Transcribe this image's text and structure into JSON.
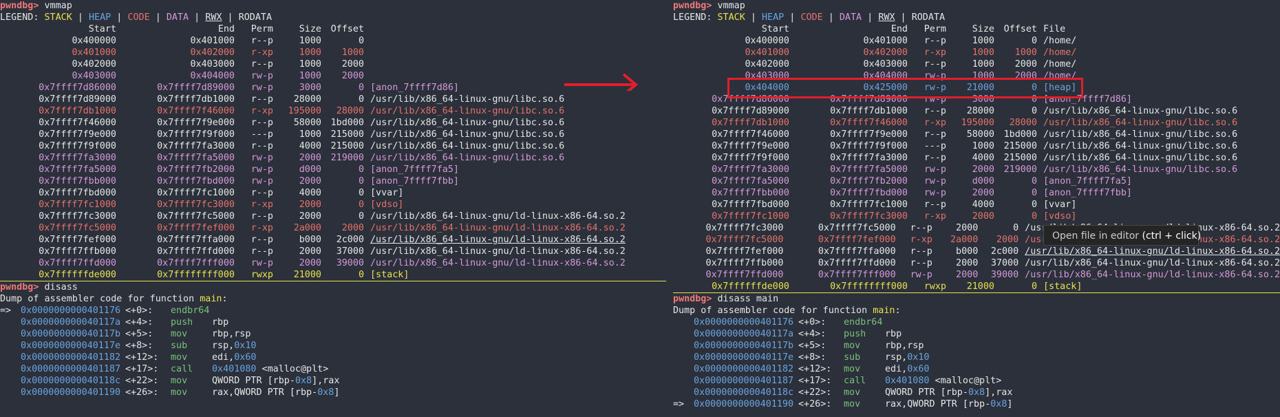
{
  "prompt": "pwndbg>",
  "legend_label": "LEGEND:",
  "legend": [
    "STACK",
    "HEAP",
    "CODE",
    "DATA",
    "RWX",
    "RODATA"
  ],
  "colors": {
    "stack": "#e8e34c",
    "heap": "#6aa4e0",
    "code": "#e5736a",
    "data": "#d59ad8",
    "rodata": "#e6e6e6",
    "annotation_red": "#e41e2a"
  },
  "left": {
    "cmd1": "vmmap",
    "headers": [
      "Start",
      "End",
      "Perm",
      "Size",
      "Offset"
    ],
    "rows": [
      {
        "start": "0x400000",
        "end": "0x401000",
        "perm": "r--p",
        "size": "1000",
        "offset": "0",
        "file": "",
        "type": "rodata"
      },
      {
        "start": "0x401000",
        "end": "0x402000",
        "perm": "r-xp",
        "size": "1000",
        "offset": "1000",
        "file": "",
        "type": "code"
      },
      {
        "start": "0x402000",
        "end": "0x403000",
        "perm": "r--p",
        "size": "1000",
        "offset": "2000",
        "file": "",
        "type": "rodata"
      },
      {
        "start": "0x403000",
        "end": "0x404000",
        "perm": "rw-p",
        "size": "1000",
        "offset": "2000",
        "file": "",
        "type": "data"
      },
      {
        "start": "0x7ffff7d86000",
        "end": "0x7ffff7d89000",
        "perm": "rw-p",
        "size": "3000",
        "offset": "0",
        "file": "[anon_7ffff7d86]",
        "type": "data"
      },
      {
        "start": "0x7ffff7d89000",
        "end": "0x7ffff7db1000",
        "perm": "r--p",
        "size": "28000",
        "offset": "0",
        "file": "/usr/lib/x86_64-linux-gnu/libc.so.6",
        "type": "rodata"
      },
      {
        "start": "0x7ffff7db1000",
        "end": "0x7ffff7f46000",
        "perm": "r-xp",
        "size": "195000",
        "offset": "28000",
        "file": "/usr/lib/x86_64-linux-gnu/libc.so.6",
        "type": "code"
      },
      {
        "start": "0x7ffff7f46000",
        "end": "0x7ffff7f9e000",
        "perm": "r--p",
        "size": "58000",
        "offset": "1bd000",
        "file": "/usr/lib/x86_64-linux-gnu/libc.so.6",
        "type": "rodata"
      },
      {
        "start": "0x7ffff7f9e000",
        "end": "0x7ffff7f9f000",
        "perm": "---p",
        "size": "1000",
        "offset": "215000",
        "file": "/usr/lib/x86_64-linux-gnu/libc.so.6",
        "type": "rodata"
      },
      {
        "start": "0x7ffff7f9f000",
        "end": "0x7ffff7fa3000",
        "perm": "r--p",
        "size": "4000",
        "offset": "215000",
        "file": "/usr/lib/x86_64-linux-gnu/libc.so.6",
        "type": "rodata"
      },
      {
        "start": "0x7ffff7fa3000",
        "end": "0x7ffff7fa5000",
        "perm": "rw-p",
        "size": "2000",
        "offset": "219000",
        "file": "/usr/lib/x86_64-linux-gnu/libc.so.6",
        "type": "data"
      },
      {
        "start": "0x7ffff7fa5000",
        "end": "0x7ffff7fb2000",
        "perm": "rw-p",
        "size": "d000",
        "offset": "0",
        "file": "[anon_7ffff7fa5]",
        "type": "data"
      },
      {
        "start": "0x7ffff7fbb000",
        "end": "0x7ffff7fbd000",
        "perm": "rw-p",
        "size": "2000",
        "offset": "0",
        "file": "[anon_7ffff7fbb]",
        "type": "data"
      },
      {
        "start": "0x7ffff7fbd000",
        "end": "0x7ffff7fc1000",
        "perm": "r--p",
        "size": "4000",
        "offset": "0",
        "file": "[vvar]",
        "type": "rodata"
      },
      {
        "start": "0x7ffff7fc1000",
        "end": "0x7ffff7fc3000",
        "perm": "r-xp",
        "size": "2000",
        "offset": "0",
        "file": "[vdso]",
        "type": "code"
      },
      {
        "start": "0x7ffff7fc3000",
        "end": "0x7ffff7fc5000",
        "perm": "r--p",
        "size": "2000",
        "offset": "0",
        "file": "/usr/lib/x86_64-linux-gnu/ld-linux-x86-64.so.2",
        "type": "rodata"
      },
      {
        "start": "0x7ffff7fc5000",
        "end": "0x7ffff7fef000",
        "perm": "r-xp",
        "size": "2a000",
        "offset": "2000",
        "file": "/usr/lib/x86_64-linux-gnu/ld-linux-x86-64.so.2",
        "type": "code"
      },
      {
        "start": "0x7ffff7fef000",
        "end": "0x7ffff7ffa000",
        "perm": "r--p",
        "size": "b000",
        "offset": "2c000",
        "file": "/usr/lib/x86_64-linux-gnu/ld-linux-x86-64.so.2",
        "type": "rodata",
        "underline": true
      },
      {
        "start": "0x7ffff7ffb000",
        "end": "0x7ffff7ffd000",
        "perm": "r--p",
        "size": "2000",
        "offset": "37000",
        "file": "/usr/lib/x86_64-linux-gnu/ld-linux-x86-64.so.2",
        "type": "rodata"
      },
      {
        "start": "0x7ffff7ffd000",
        "end": "0x7ffff7fff000",
        "perm": "rw-p",
        "size": "2000",
        "offset": "39000",
        "file": "/usr/lib/x86_64-linux-gnu/ld-linux-x86-64.so.2",
        "type": "data"
      },
      {
        "start": "0x7ffffffde000",
        "end": "0x7ffffffff000",
        "perm": "rwxp",
        "size": "21000",
        "offset": "0",
        "file": "[stack]",
        "type": "stack"
      }
    ],
    "cmd2": "disass",
    "dump_prefix": "Dump of assembler code for function ",
    "dump_fn": "main",
    "dump_suffix": ":",
    "asm": [
      {
        "arrow": "=>",
        "addr": "0x0000000000401176",
        "off": "<+0>:",
        "mnem": "endbr64",
        "ops": ""
      },
      {
        "arrow": "",
        "addr": "0x000000000040117a",
        "off": "<+4>:",
        "mnem": "push",
        "ops": "rbp"
      },
      {
        "arrow": "",
        "addr": "0x000000000040117b",
        "off": "<+5>:",
        "mnem": "mov",
        "ops": "rbp,rsp"
      },
      {
        "arrow": "",
        "addr": "0x000000000040117e",
        "off": "<+8>:",
        "mnem": "sub",
        "ops": "rsp,0x10"
      },
      {
        "arrow": "",
        "addr": "0x0000000000401182",
        "off": "<+12>:",
        "mnem": "mov",
        "ops": "edi,0x60"
      },
      {
        "arrow": "",
        "addr": "0x0000000000401187",
        "off": "<+17>:",
        "mnem": "call",
        "ops": "0x401080 <malloc@plt>"
      },
      {
        "arrow": "",
        "addr": "0x000000000040118c",
        "off": "<+22>:",
        "mnem": "mov",
        "ops": "QWORD PTR [rbp-0x8],rax"
      },
      {
        "arrow": "",
        "addr": "0x0000000000401190",
        "off": "<+26>:",
        "mnem": "mov",
        "ops": "rax,QWORD PTR [rbp-0x8]"
      }
    ]
  },
  "right": {
    "cmd1": "vmmap",
    "headers": [
      "Start",
      "End",
      "Perm",
      "Size",
      "Offset",
      "File"
    ],
    "rows": [
      {
        "start": "0x400000",
        "end": "0x401000",
        "perm": "r--p",
        "size": "1000",
        "offset": "0",
        "file": "/home/",
        "type": "rodata"
      },
      {
        "start": "0x401000",
        "end": "0x402000",
        "perm": "r-xp",
        "size": "1000",
        "offset": "1000",
        "file": "/home/",
        "type": "code"
      },
      {
        "start": "0x402000",
        "end": "0x403000",
        "perm": "r--p",
        "size": "1000",
        "offset": "2000",
        "file": "/home/",
        "type": "rodata"
      },
      {
        "start": "0x403000",
        "end": "0x404000",
        "perm": "rw-p",
        "size": "1000",
        "offset": "2000",
        "file": "/home/",
        "type": "data"
      },
      {
        "start": "0x404000",
        "end": "0x425000",
        "perm": "rw-p",
        "size": "21000",
        "offset": "0",
        "file": "[heap]",
        "type": "heap",
        "highlight": true
      },
      {
        "start": "0x7ffff7d86000",
        "end": "0x7ffff7d89000",
        "perm": "rw-p",
        "size": "3000",
        "offset": "0",
        "file": "[anon_7ffff7d86]",
        "type": "data"
      },
      {
        "start": "0x7ffff7d89000",
        "end": "0x7ffff7db1000",
        "perm": "r--p",
        "size": "28000",
        "offset": "0",
        "file": "/usr/lib/x86_64-linux-gnu/libc.so.6",
        "type": "rodata"
      },
      {
        "start": "0x7ffff7db1000",
        "end": "0x7ffff7f46000",
        "perm": "r-xp",
        "size": "195000",
        "offset": "28000",
        "file": "/usr/lib/x86_64-linux-gnu/libc.so.6",
        "type": "code"
      },
      {
        "start": "0x7ffff7f46000",
        "end": "0x7ffff7f9e000",
        "perm": "r--p",
        "size": "58000",
        "offset": "1bd000",
        "file": "/usr/lib/x86_64-linux-gnu/libc.so.6",
        "type": "rodata"
      },
      {
        "start": "0x7ffff7f9e000",
        "end": "0x7ffff7f9f000",
        "perm": "---p",
        "size": "1000",
        "offset": "215000",
        "file": "/usr/lib/x86_64-linux-gnu/libc.so.6",
        "type": "rodata"
      },
      {
        "start": "0x7ffff7f9f000",
        "end": "0x7ffff7fa3000",
        "perm": "r--p",
        "size": "4000",
        "offset": "215000",
        "file": "/usr/lib/x86_64-linux-gnu/libc.so.6",
        "type": "rodata"
      },
      {
        "start": "0x7ffff7fa3000",
        "end": "0x7ffff7fa5000",
        "perm": "rw-p",
        "size": "2000",
        "offset": "219000",
        "file": "/usr/lib/x86_64-linux-gnu/libc.so.6",
        "type": "data"
      },
      {
        "start": "0x7ffff7fa5000",
        "end": "0x7ffff7fb2000",
        "perm": "rw-p",
        "size": "d000",
        "offset": "0",
        "file": "[anon_7ffff7fa5]",
        "type": "data"
      },
      {
        "start": "0x7ffff7fbb000",
        "end": "0x7ffff7fbd000",
        "perm": "rw-p",
        "size": "2000",
        "offset": "0",
        "file": "[anon_7ffff7fbb]",
        "type": "data"
      },
      {
        "start": "0x7ffff7fbd000",
        "end": "0x7ffff7fc1000",
        "perm": "r--p",
        "size": "4000",
        "offset": "0",
        "file": "[vvar]",
        "type": "rodata"
      },
      {
        "start": "0x7ffff7fc1000",
        "end": "0x7ffff7fc3000",
        "perm": "r-xp",
        "size": "2000",
        "offset": "0",
        "file": "[vdso]",
        "type": "code"
      },
      {
        "start": "0x7ffff7fc3000",
        "end": "0x7ffff7fc5000",
        "perm": "r--p",
        "size": "2000",
        "offset": "0",
        "file": "/usr/lib/x86_64-linux-gnu/ld-linux-x86-64.so.2",
        "type": "rodata"
      },
      {
        "start": "0x7ffff7fc5000",
        "end": "0x7ffff7fef000",
        "perm": "r-xp",
        "size": "2a000",
        "offset": "2000",
        "file": "/usr/lib/x86_64-linux-gnu/ld-linux-x86-64.so.2",
        "type": "code"
      },
      {
        "start": "0x7ffff7fef000",
        "end": "0x7ffff7ffa000",
        "perm": "r--p",
        "size": "b000",
        "offset": "2c000",
        "file": "/usr/lib/x86_64-linux-gnu/ld-linux-x86-64.so.2",
        "type": "rodata",
        "underline": true
      },
      {
        "start": "0x7ffff7ffb000",
        "end": "0x7ffff7ffd000",
        "perm": "r--p",
        "size": "2000",
        "offset": "37000",
        "file": "/usr/lib/x86_64-linux-gnu/ld-linux-x86-64.so.2",
        "type": "rodata"
      },
      {
        "start": "0x7ffff7ffd000",
        "end": "0x7ffff7fff000",
        "perm": "rw-p",
        "size": "2000",
        "offset": "39000",
        "file": "/usr/lib/x86_64-linux-gnu/ld-linux-x86-64.so.2",
        "type": "data"
      },
      {
        "start": "0x7ffffffde000",
        "end": "0x7ffffffff000",
        "perm": "rwxp",
        "size": "21000",
        "offset": "0",
        "file": "[stack]",
        "type": "stack"
      }
    ],
    "cmd2": "disass main",
    "dump_prefix": "Dump of assembler code for function ",
    "dump_fn": "main",
    "dump_suffix": ":",
    "asm": [
      {
        "arrow": "",
        "addr": "0x0000000000401176",
        "off": "<+0>:",
        "mnem": "endbr64",
        "ops": ""
      },
      {
        "arrow": "",
        "addr": "0x000000000040117a",
        "off": "<+4>:",
        "mnem": "push",
        "ops": "rbp"
      },
      {
        "arrow": "",
        "addr": "0x000000000040117b",
        "off": "<+5>:",
        "mnem": "mov",
        "ops": "rbp,rsp"
      },
      {
        "arrow": "",
        "addr": "0x000000000040117e",
        "off": "<+8>:",
        "mnem": "sub",
        "ops": "rsp,0x10"
      },
      {
        "arrow": "",
        "addr": "0x0000000000401182",
        "off": "<+12>:",
        "mnem": "mov",
        "ops": "edi,0x60"
      },
      {
        "arrow": "",
        "addr": "0x0000000000401187",
        "off": "<+17>:",
        "mnem": "call",
        "ops": "0x401080 <malloc@plt>"
      },
      {
        "arrow": "",
        "addr": "0x000000000040118c",
        "off": "<+22>:",
        "mnem": "mov",
        "ops": "QWORD PTR [rbp-0x8],rax"
      },
      {
        "arrow": "=>",
        "addr": "0x0000000000401190",
        "off": "<+26>:",
        "mnem": "mov",
        "ops": "rax,QWORD PTR [rbp-0x8]"
      }
    ]
  },
  "tooltip": {
    "text": "Open file in editor",
    "hint": "(ctrl + click)"
  }
}
